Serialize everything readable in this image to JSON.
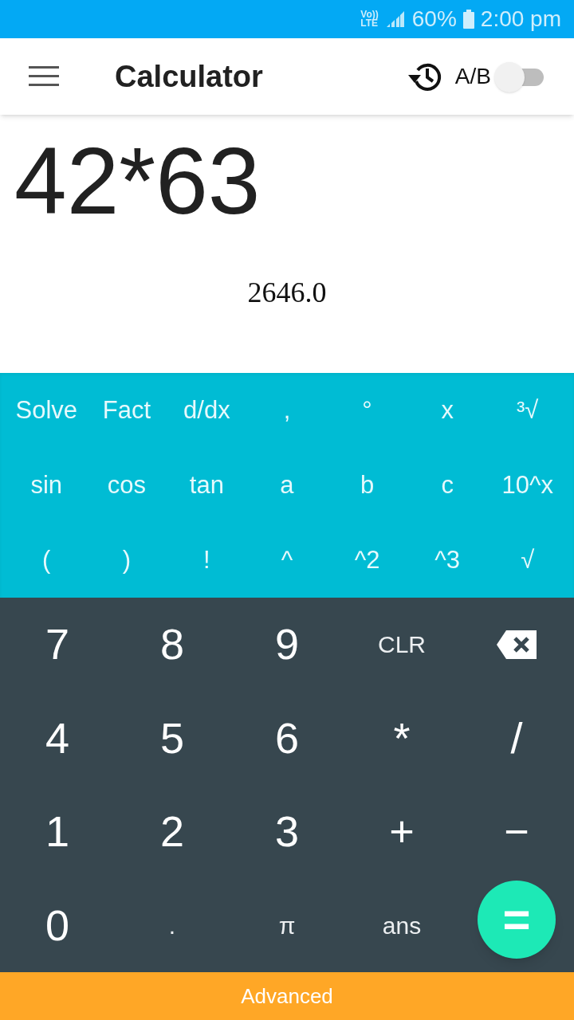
{
  "status_bar": {
    "network": "Vo)) LTE",
    "battery": "60%",
    "time": "2:00 pm"
  },
  "app_bar": {
    "title": "Calculator",
    "toggle_label": "A/B",
    "toggle": {
      "on": false
    }
  },
  "display": {
    "expression": "42*63",
    "result": "2646.0"
  },
  "advanced_keys": [
    [
      "Solve",
      "Fact",
      "d/dx",
      ",",
      "°",
      "x",
      "³√"
    ],
    [
      "sin",
      "cos",
      "tan",
      "a",
      "b",
      "c",
      "10^x"
    ],
    [
      "(",
      ")",
      "!",
      "^",
      "^2",
      "^3",
      "√"
    ]
  ],
  "keypad": [
    [
      {
        "kind": "digit",
        "label": "7"
      },
      {
        "kind": "digit",
        "label": "8"
      },
      {
        "kind": "digit",
        "label": "9"
      },
      {
        "kind": "word",
        "label": "CLR"
      },
      {
        "kind": "backspace"
      }
    ],
    [
      {
        "kind": "digit",
        "label": "4"
      },
      {
        "kind": "digit",
        "label": "5"
      },
      {
        "kind": "digit",
        "label": "6"
      },
      {
        "kind": "digit",
        "label": "*"
      },
      {
        "kind": "digit",
        "label": "/"
      }
    ],
    [
      {
        "kind": "digit",
        "label": "1"
      },
      {
        "kind": "digit",
        "label": "2"
      },
      {
        "kind": "digit",
        "label": "3"
      },
      {
        "kind": "digit",
        "label": "+"
      },
      {
        "kind": "digit",
        "label": "−"
      }
    ],
    [
      {
        "kind": "digit",
        "label": "0"
      },
      {
        "kind": "word",
        "label": "."
      },
      {
        "kind": "word",
        "label": "π"
      },
      {
        "kind": "word",
        "label": "ans"
      },
      {
        "kind": "fab",
        "label": "="
      }
    ]
  ],
  "bottom_bar": {
    "label": "Advanced"
  }
}
